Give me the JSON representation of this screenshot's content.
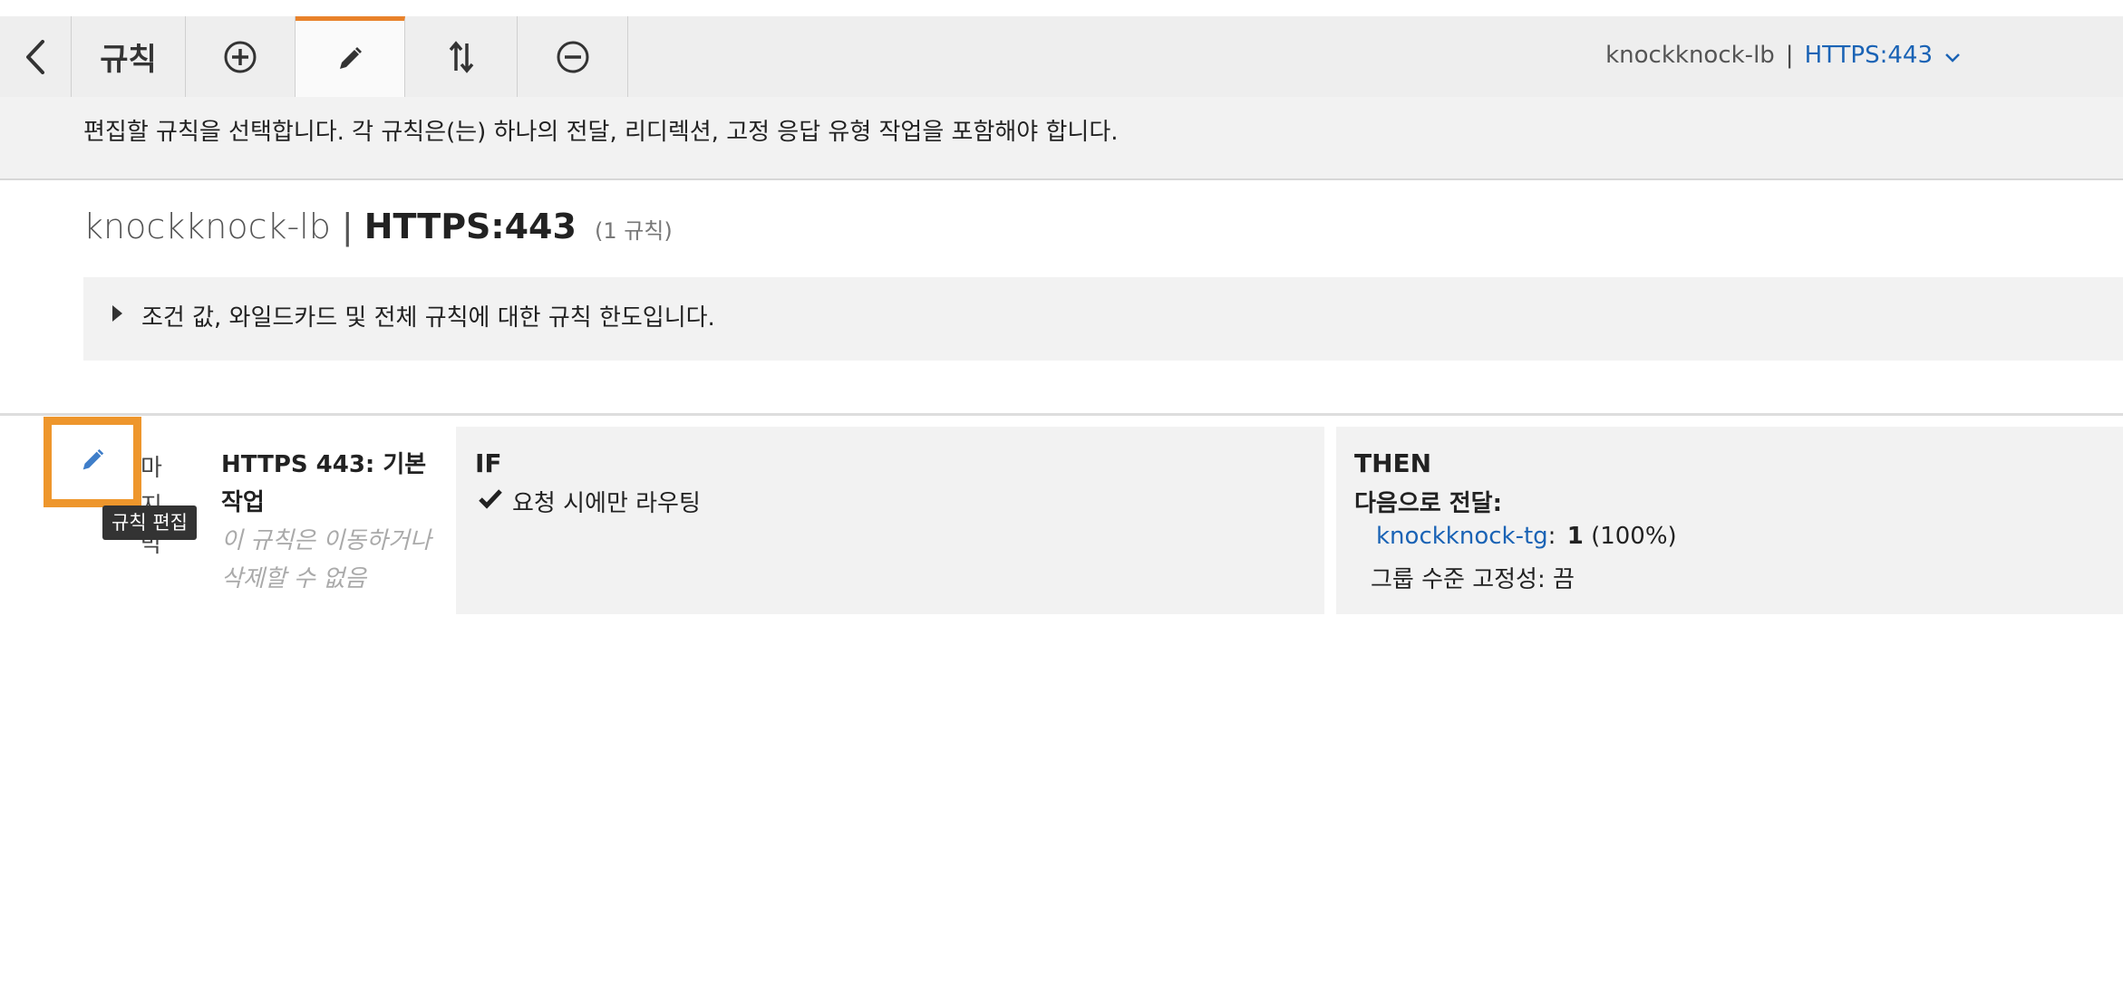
{
  "toolbar": {
    "title": "규칙",
    "back_icon": "chevron-left-icon",
    "add_icon": "plus-circle-icon",
    "edit_icon": "pencil-icon",
    "reorder_icon": "up-down-arrows-icon",
    "delete_icon": "minus-circle-icon",
    "lb_name": "knockknock-lb",
    "separator": "|",
    "listener": "HTTPS:443",
    "dropdown_icon": "chevron-down-icon",
    "active_tab_color": "#e9822a"
  },
  "info": {
    "text": "편집할 규칙을 선택합니다. 각 규칙은(는) 하나의 전달, 리디렉션, 고정 응답 유형 작업을 포함해야 합니다."
  },
  "heading": {
    "lb_name": "knockknock-lb",
    "separator": "|",
    "listener": "HTTPS:443",
    "rule_count": "(1 규칙)"
  },
  "limits": {
    "text": "조건 값, 와일드카드 및 전체 규칙에 대한 규칙 한도입니다."
  },
  "rule": {
    "priority_fragments": [
      "마",
      "지",
      "막"
    ],
    "name": "HTTPS 443: 기본 작업",
    "note": "이 규칙은 이동하거나 삭제할 수 없음",
    "edit_tooltip": "규칙 편집",
    "edit_icon": "pencil-icon",
    "if": {
      "label": "IF",
      "condition": "요청 시에만 라우팅",
      "check_icon": "checkmark-icon"
    },
    "then": {
      "label": "THEN",
      "action": "다음으로 전달:",
      "target_group": "knockknock-tg",
      "target_colon": ":",
      "weight": "1",
      "percent": "(100%)",
      "stickiness": "그룹 수준 고정성: 끔"
    }
  },
  "colors": {
    "accent": "#e9822a",
    "highlight": "#ee962c",
    "link": "#1a63b5",
    "edit_icon": "#3f7ec9"
  }
}
